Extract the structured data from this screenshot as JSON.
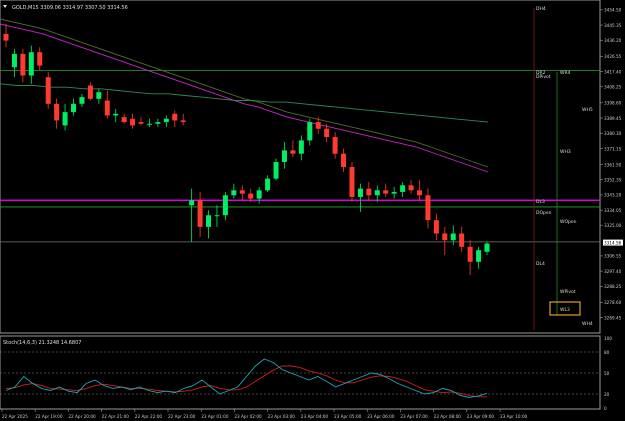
{
  "header": {
    "title": "GOLD,M15  3309.06 3314.97 3307.50 3314.56"
  },
  "osc": {
    "title": "Stoch(14,6,3) 21.3248 14.6807",
    "axis": [
      "100",
      "80",
      "50",
      "20",
      "0"
    ]
  },
  "price_axis": [
    "3454.50",
    "3445.35",
    "3436.20",
    "3426.55",
    "3417.40",
    "3408.25",
    "3398.60",
    "3389.45",
    "3380.30",
    "3371.15",
    "3361.50",
    "3352.35",
    "3343.20",
    "3334.05",
    "3325.00",
    "3314.56",
    "3306.55",
    "3297.40",
    "3288.25",
    "3278.60",
    "3269.45"
  ],
  "current_price": "3314.56",
  "time_axis": [
    "22 Apr 2025",
    "22 Apr 19:00",
    "22 Apr 20:00",
    "22 Apr 21:00",
    "22 Apr 22:00",
    "22 Apr 23:00",
    "23 Apr 01:00",
    "23 Apr 02:00",
    "23 Apr 03:00",
    "23 Apr 04:00",
    "23 Apr 05:00",
    "23 Apr 06:00",
    "23 Apr 07:00",
    "23 Apr 08:00",
    "23 Apr 09:00",
    "23 Apr 10:00"
  ],
  "pivot_labels": [
    "DH4",
    "DR2",
    "DPivot",
    "WR4",
    "WH5",
    "WH3",
    "DL3",
    "DOpen",
    "WOpen",
    "DL4",
    "WPivot",
    "WL3",
    "WH4"
  ],
  "colors": {
    "bull": "#00ee66",
    "bear": "#ff3b2f",
    "green_level": "#22aa22",
    "magenta_level": "#ff00ff",
    "stoch_main": "#1ba8b8",
    "stoch_signal": "#cc2222",
    "ma_fast": "#cc22cc",
    "ma_mid": "#556b2f",
    "ma_slow": "#2e8b57"
  },
  "chart_data": {
    "type": "candlestick",
    "series": [
      {
        "o": 3440,
        "h": 3446,
        "l": 3432,
        "c": 3436
      },
      {
        "o": 3420,
        "h": 3431,
        "l": 3414,
        "c": 3428
      },
      {
        "o": 3428,
        "h": 3431,
        "l": 3411,
        "c": 3415
      },
      {
        "o": 3415,
        "h": 3433,
        "l": 3410,
        "c": 3429
      },
      {
        "o": 3429,
        "h": 3432,
        "l": 3418,
        "c": 3421
      },
      {
        "o": 3414,
        "h": 3417,
        "l": 3395,
        "c": 3398
      },
      {
        "o": 3398,
        "h": 3401,
        "l": 3383,
        "c": 3388
      },
      {
        "o": 3385,
        "h": 3398,
        "l": 3382,
        "c": 3393
      },
      {
        "o": 3393,
        "h": 3401,
        "l": 3391,
        "c": 3398
      },
      {
        "o": 3398,
        "h": 3404,
        "l": 3396,
        "c": 3402
      },
      {
        "o": 3409,
        "h": 3411,
        "l": 3400,
        "c": 3401
      },
      {
        "o": 3401,
        "h": 3407,
        "l": 3398,
        "c": 3405
      },
      {
        "o": 3400,
        "h": 3406,
        "l": 3389,
        "c": 3391
      },
      {
        "o": 3391,
        "h": 3395,
        "l": 3387,
        "c": 3392
      },
      {
        "o": 3390,
        "h": 3392,
        "l": 3386,
        "c": 3387
      },
      {
        "o": 3389,
        "h": 3392,
        "l": 3383,
        "c": 3385
      },
      {
        "o": 3387,
        "h": 3390,
        "l": 3385,
        "c": 3386
      },
      {
        "o": 3386,
        "h": 3389,
        "l": 3384,
        "c": 3386
      },
      {
        "o": 3386,
        "h": 3389,
        "l": 3384,
        "c": 3387
      },
      {
        "o": 3387,
        "h": 3391,
        "l": 3384,
        "c": 3389
      },
      {
        "o": 3392,
        "h": 3394,
        "l": 3384,
        "c": 3388
      },
      {
        "o": 3388,
        "h": 3392,
        "l": 3385,
        "c": 3387
      },
      {
        "o": 3337,
        "h": 3347,
        "l": 3315,
        "c": 3340
      },
      {
        "o": 3340,
        "h": 3345,
        "l": 3318,
        "c": 3324
      },
      {
        "o": 3324,
        "h": 3334,
        "l": 3317,
        "c": 3331
      },
      {
        "o": 3331,
        "h": 3337,
        "l": 3324,
        "c": 3331
      },
      {
        "o": 3331,
        "h": 3345,
        "l": 3328,
        "c": 3343
      },
      {
        "o": 3343,
        "h": 3350,
        "l": 3341,
        "c": 3346
      },
      {
        "o": 3346,
        "h": 3349,
        "l": 3340,
        "c": 3344
      },
      {
        "o": 3344,
        "h": 3347,
        "l": 3339,
        "c": 3341
      },
      {
        "o": 3341,
        "h": 3348,
        "l": 3338,
        "c": 3346
      },
      {
        "o": 3346,
        "h": 3355,
        "l": 3345,
        "c": 3353
      },
      {
        "o": 3353,
        "h": 3365,
        "l": 3352,
        "c": 3363
      },
      {
        "o": 3363,
        "h": 3375,
        "l": 3359,
        "c": 3370
      },
      {
        "o": 3370,
        "h": 3376,
        "l": 3366,
        "c": 3368
      },
      {
        "o": 3368,
        "h": 3379,
        "l": 3364,
        "c": 3376
      },
      {
        "o": 3376,
        "h": 3389,
        "l": 3373,
        "c": 3387
      },
      {
        "o": 3387,
        "h": 3390,
        "l": 3380,
        "c": 3383
      },
      {
        "o": 3383,
        "h": 3386,
        "l": 3375,
        "c": 3378
      },
      {
        "o": 3378,
        "h": 3381,
        "l": 3365,
        "c": 3368
      },
      {
        "o": 3368,
        "h": 3371,
        "l": 3357,
        "c": 3360
      },
      {
        "o": 3360,
        "h": 3363,
        "l": 3339,
        "c": 3342
      },
      {
        "o": 3342,
        "h": 3350,
        "l": 3333,
        "c": 3347
      },
      {
        "o": 3347,
        "h": 3351,
        "l": 3340,
        "c": 3343
      },
      {
        "o": 3343,
        "h": 3349,
        "l": 3339,
        "c": 3346
      },
      {
        "o": 3346,
        "h": 3350,
        "l": 3342,
        "c": 3344
      },
      {
        "o": 3344,
        "h": 3348,
        "l": 3341,
        "c": 3345
      },
      {
        "o": 3345,
        "h": 3351,
        "l": 3342,
        "c": 3349
      },
      {
        "o": 3349,
        "h": 3352,
        "l": 3344,
        "c": 3346
      },
      {
        "o": 3346,
        "h": 3352,
        "l": 3340,
        "c": 3343
      },
      {
        "o": 3343,
        "h": 3347,
        "l": 3323,
        "c": 3328
      },
      {
        "o": 3328,
        "h": 3332,
        "l": 3316,
        "c": 3320
      },
      {
        "o": 3320,
        "h": 3324,
        "l": 3307,
        "c": 3316
      },
      {
        "o": 3316,
        "h": 3325,
        "l": 3313,
        "c": 3320
      },
      {
        "o": 3320,
        "h": 3324,
        "l": 3309,
        "c": 3312
      },
      {
        "o": 3312,
        "h": 3316,
        "l": 3295,
        "c": 3303
      },
      {
        "o": 3303,
        "h": 3312,
        "l": 3299,
        "c": 3310
      },
      {
        "o": 3309,
        "h": 3315,
        "l": 3307,
        "c": 3314
      }
    ],
    "ylim": [
      3262,
      3458
    ],
    "levels": [
      3418,
      3340,
      3336,
      3315
    ],
    "ma_fast": [
      3446,
      3444,
      3442,
      3440,
      3437,
      3434,
      3431,
      3428,
      3425,
      3422,
      3419,
      3416,
      3413,
      3410,
      3407,
      3404,
      3401,
      3398,
      3396,
      3393,
      3390,
      3388,
      3386,
      3384,
      3382,
      3380,
      3378,
      3376,
      3374,
      3372,
      3369,
      3366,
      3363,
      3360,
      3357
    ],
    "ma_slow": [
      3410,
      3409,
      3409,
      3408,
      3408,
      3407,
      3407,
      3406,
      3405,
      3404,
      3404,
      3403,
      3402,
      3401,
      3400,
      3400,
      3399,
      3399,
      3398,
      3397,
      3396,
      3395,
      3394,
      3393,
      3392,
      3391,
      3390,
      3389,
      3388,
      3387
    ],
    "stoch_k": [
      25,
      30,
      45,
      35,
      28,
      25,
      30,
      24,
      22,
      35,
      40,
      32,
      28,
      30,
      26,
      30,
      25,
      22,
      24,
      22,
      28,
      32,
      40,
      30,
      20,
      25,
      30,
      45,
      60,
      70,
      65,
      55,
      50,
      45,
      40,
      45,
      38,
      30,
      35,
      40,
      45,
      50,
      48,
      42,
      35,
      30,
      25,
      20,
      22,
      28,
      25,
      18,
      15,
      17,
      21
    ],
    "stoch_d": [
      28,
      29,
      33,
      35,
      32,
      28,
      27,
      26,
      25,
      28,
      32,
      34,
      32,
      30,
      28,
      28,
      27,
      25,
      24,
      23,
      24,
      26,
      30,
      32,
      28,
      26,
      26,
      30,
      38,
      46,
      54,
      60,
      60,
      58,
      53,
      50,
      46,
      40,
      36,
      36,
      40,
      44,
      46,
      45,
      42,
      38,
      32,
      26,
      24,
      22,
      23,
      21,
      18,
      16,
      16
    ]
  }
}
